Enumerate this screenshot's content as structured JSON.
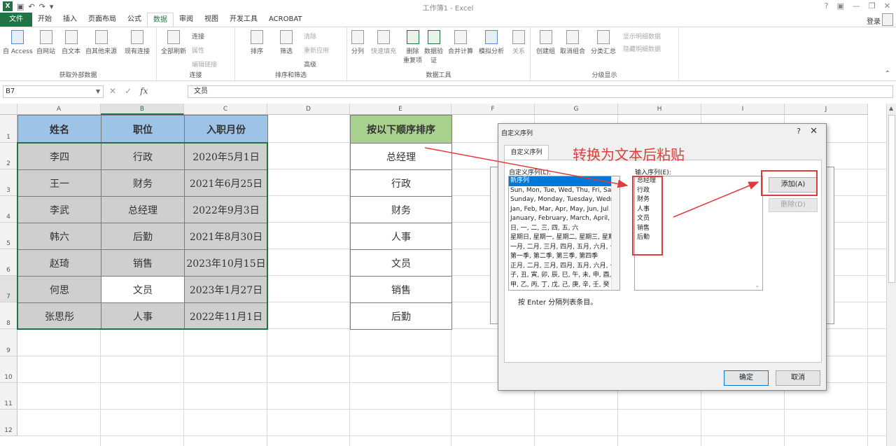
{
  "app": {
    "title": "工作簿1 - Excel",
    "login": "登录"
  },
  "tabs": [
    "文件",
    "开始",
    "插入",
    "页面布局",
    "公式",
    "数据",
    "审阅",
    "视图",
    "开发工具",
    "ACROBAT"
  ],
  "ribbon": {
    "get_external": {
      "label": "获取外部数据",
      "buttons": [
        "自 Access",
        "自网站",
        "自文本",
        "自其他来源",
        "现有连接"
      ]
    },
    "connections": {
      "label": "连接",
      "refresh": "全部刷新",
      "items": [
        "连接",
        "属性",
        "编辑链接"
      ]
    },
    "sort_filter": {
      "label": "排序和筛选",
      "sort": "排序",
      "filter": "筛选",
      "items": [
        "清除",
        "重新应用",
        "高级"
      ]
    },
    "data_tools": {
      "label": "数据工具",
      "buttons": [
        "分列",
        "快速填充",
        "删除\n重复项",
        "数据验\n证",
        "合并计算",
        "模拟分析",
        "关系"
      ]
    },
    "outline": {
      "label": "分级显示",
      "buttons": [
        "创建组",
        "取消组合",
        "分类汇总"
      ],
      "items": [
        "显示明细数据",
        "隐藏明细数据"
      ]
    }
  },
  "formula_bar": {
    "name_box": "B7",
    "value": "文员"
  },
  "columns": [
    "A",
    "B",
    "C",
    "D",
    "E",
    "F",
    "G",
    "H",
    "I",
    "J"
  ],
  "rows": [
    "1",
    "2",
    "3",
    "4",
    "5",
    "6",
    "7",
    "8",
    "9",
    "10",
    "11",
    "12"
  ],
  "table": {
    "headers": [
      "姓名",
      "职位",
      "入职月份"
    ],
    "rows": [
      [
        "李四",
        "行政",
        "2020年5月1日"
      ],
      [
        "王一",
        "财务",
        "2021年6月25日"
      ],
      [
        "李武",
        "总经理",
        "2022年9月3日"
      ],
      [
        "韩六",
        "后勤",
        "2021年8月30日"
      ],
      [
        "赵琦",
        "销售",
        "2023年10月15日"
      ],
      [
        "何思",
        "文员",
        "2023年1月27日"
      ],
      [
        "张思彤",
        "人事",
        "2022年11月1日"
      ]
    ]
  },
  "order": {
    "header": "按以下顺序排序",
    "items": [
      "总经理",
      "行政",
      "财务",
      "人事",
      "文员",
      "销售",
      "后勤"
    ]
  },
  "dialog": {
    "title": "自定义序列",
    "tab": "自定义序列",
    "list_label": "自定义序列(L):",
    "input_label": "输入序列(E):",
    "lists": [
      "新序列",
      "Sun, Mon, Tue, Wed, Thu, Fri, Sat",
      "Sunday, Monday, Tuesday, Wednesday",
      "Jan, Feb, Mar, Apr, May, Jun, Jul",
      "January, February, March, April,",
      "日, 一, 二, 三, 四, 五, 六",
      "星期日, 星期一, 星期二, 星期三, 星期",
      "一月, 二月, 三月, 四月, 五月, 六月, 七",
      "第一季, 第二季, 第三季, 第四季",
      "正月, 二月, 三月, 四月, 五月, 六月, 七",
      "子, 丑, 寅, 卯, 辰, 巳, 午, 未, 申, 酉,",
      "甲, 乙, 丙, 丁, 戊, 己, 庚, 辛, 壬, 癸"
    ],
    "entries": [
      "总经理",
      "行政",
      "财务",
      "人事",
      "文员",
      "销售",
      "后勤"
    ],
    "hint": "按 Enter 分隔列表条目。",
    "add": "添加(A)",
    "delete": "删除(D)",
    "ok": "确定",
    "cancel": "取消"
  },
  "annotation": "转换为文本后粘贴",
  "colors": {
    "excel_green": "#217346",
    "header_blue": "#9dc3e6",
    "header_green": "#a9d18e",
    "annotation_red": "#e23a3a"
  }
}
